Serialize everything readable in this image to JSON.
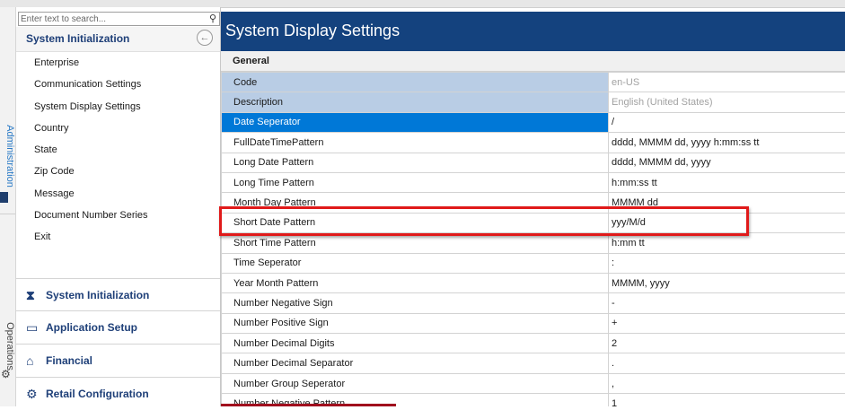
{
  "rail": {
    "admin_label": "Administration",
    "ops_label": "Operations"
  },
  "search": {
    "placeholder": "Enter text to search..."
  },
  "sidebar": {
    "section_title": "System Initialization",
    "items": [
      "Enterprise",
      "Communication Settings",
      "System Display Settings",
      "Country",
      "State",
      "Zip Code",
      "Message",
      "Document Number Series",
      "Exit"
    ],
    "groups": [
      {
        "label": "System Initialization",
        "icon": "hourglass-icon"
      },
      {
        "label": "Application Setup",
        "icon": "window-icon"
      },
      {
        "label": "Financial",
        "icon": "bank-icon"
      },
      {
        "label": "Retail Configuration",
        "icon": "gears-icon"
      }
    ]
  },
  "main": {
    "title": "System Display Settings",
    "group_title": "General",
    "rows": [
      {
        "key": "Code",
        "value": "en-US",
        "state": "readonly"
      },
      {
        "key": "Description",
        "value": "English (United States)",
        "state": "readonly"
      },
      {
        "key": "Date Seperator",
        "value": "/",
        "state": "selected"
      },
      {
        "key": "FullDateTimePattern",
        "value": "dddd, MMMM dd, yyyy h:mm:ss tt",
        "state": "normal"
      },
      {
        "key": "Long Date Pattern",
        "value": "dddd, MMMM dd, yyyy",
        "state": "normal"
      },
      {
        "key": "Long Time Pattern",
        "value": "h:mm:ss tt",
        "state": "normal"
      },
      {
        "key": "Month Day Pattern",
        "value": "MMMM dd",
        "state": "normal"
      },
      {
        "key": "Short Date Pattern",
        "value": "yyy/M/d",
        "state": "normal"
      },
      {
        "key": "Short Time Pattern",
        "value": "h:mm tt",
        "state": "normal"
      },
      {
        "key": "Time Seperator",
        "value": ":",
        "state": "normal"
      },
      {
        "key": "Year Month Pattern",
        "value": "MMMM, yyyy",
        "state": "normal"
      },
      {
        "key": "Number Negative Sign",
        "value": "-",
        "state": "normal"
      },
      {
        "key": "Number Positive Sign",
        "value": "+",
        "state": "normal"
      },
      {
        "key": "Number Decimal Digits",
        "value": "2",
        "state": "normal"
      },
      {
        "key": "Number Decimal Separator",
        "value": ".",
        "state": "normal"
      },
      {
        "key": "Number Group Seperator",
        "value": ",",
        "state": "normal"
      },
      {
        "key": "Number Negative Pattern",
        "value": "1",
        "state": "normal"
      }
    ]
  },
  "colors": {
    "title_bar": "#14427e",
    "readonly_key_bg": "#b9cde5",
    "selected_key_bg": "#0078d7",
    "highlight_border": "#e01a1a"
  }
}
